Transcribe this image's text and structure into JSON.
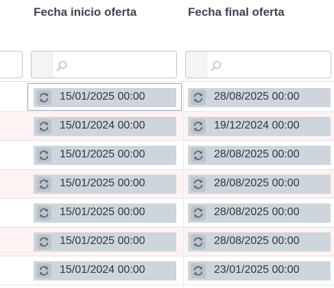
{
  "columns": [
    {
      "header": "Fecha inicio oferta"
    },
    {
      "header": "Fecha final oferta"
    }
  ],
  "icons": {
    "filter": "search-icon",
    "cell_action": "refresh-icon"
  },
  "rows": [
    {
      "start": "15/01/2025 00:00",
      "end": "28/08/2025 00:00"
    },
    {
      "start": "15/01/2024 00:00",
      "end": "19/12/2024 00:00"
    },
    {
      "start": "15/01/2025 00:00",
      "end": "28/08/2025 00:00"
    },
    {
      "start": "15/01/2025 00:00",
      "end": "28/08/2025 00:00"
    },
    {
      "start": "15/01/2025 00:00",
      "end": "28/08/2025 00:00"
    },
    {
      "start": "15/01/2025 00:00",
      "end": "28/08/2025 00:00"
    },
    {
      "start": "15/01/2024 00:00",
      "end": "23/01/2025 00:00"
    }
  ],
  "colors": {
    "row_alt": "#fdf3f3",
    "cell_bg": "#cfd5dc",
    "header_text": "#3a4450"
  }
}
